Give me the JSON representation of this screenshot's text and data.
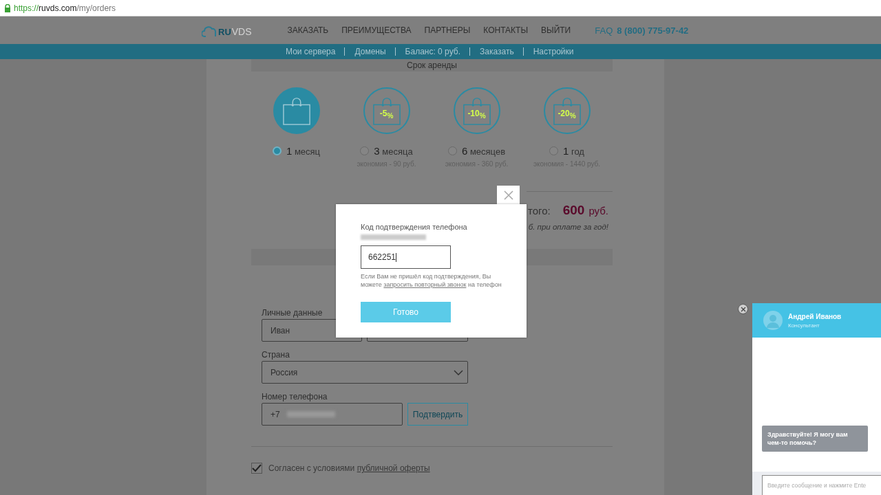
{
  "address_bar": {
    "scheme": "https://",
    "host": "ruvds.com",
    "path": "/my/orders"
  },
  "header": {
    "logo_ru": "RU",
    "logo_vds": "VDS",
    "nav": [
      "ЗАКАЗАТЬ",
      "ПРЕИМУЩЕСТВА",
      "ПАРТНЕРЫ",
      "КОНТАКТЫ",
      "ВЫЙТИ"
    ],
    "faq": "FAQ",
    "phone": "8 (800) 775-97-42"
  },
  "subnav": [
    "Мои сервера",
    "Домены",
    "Баланс: 0 руб.",
    "Заказать",
    "Настройки"
  ],
  "rental": {
    "title": "Срок аренды",
    "options": [
      {
        "count": "1",
        "unit": "месяц",
        "selected": true
      },
      {
        "badge": "-5$_{%}$",
        "count": "3",
        "unit": "месяца",
        "savings": "экономия - 90 руб.",
        "selected": false
      },
      {
        "badge": "-10$_{%}$",
        "count": "6",
        "unit": "месяцев",
        "savings": "экономия - 360 руб.",
        "selected": false
      },
      {
        "badge": "-20$_{%}$",
        "count": "1",
        "unit": "год",
        "savings": "экономия - 1440 руб.",
        "selected": false
      }
    ]
  },
  "total": {
    "label": "того:",
    "amount": "600",
    "currency": "руб.",
    "note": "б. при оплате за год!"
  },
  "form": {
    "personal_label": "Личные данные",
    "first_name": "Иван",
    "country_label": "Страна",
    "country": "Россия",
    "phone_label": "Номер телефона",
    "phone_prefix": "+7",
    "confirm": "Подтвердить",
    "agree_checked": true,
    "agree_text": "Согласен с условиями",
    "agree_link": "публичной оферты"
  },
  "modal": {
    "title": "Код подтверждения телефона",
    "code": "662251",
    "help_before": "Если Вам не пришёл код подтверждения, Вы можете",
    "help_link": "запросить повторный звонок",
    "help_after": "на телефон",
    "button": "Готово"
  },
  "chat": {
    "name": "Андрей Иванов",
    "role": "Консультант",
    "message": "Здравствуйте! Я могу вам чем-то помочь?",
    "placeholder": "Введите сообщение и нажмите Ente"
  }
}
